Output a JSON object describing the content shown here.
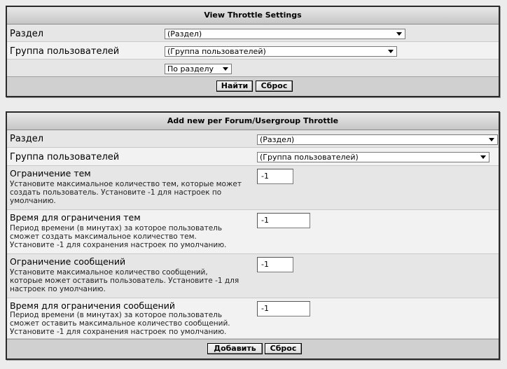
{
  "view_panel": {
    "title": "View Throttle Settings",
    "forum_label": "Раздел",
    "forum_value": "(Раздел)",
    "usergroup_label": "Группа пользователей",
    "usergroup_value": "(Группа пользователей)",
    "sort_value": "По разделу",
    "find_button": "Найти",
    "reset_button": "Сброс"
  },
  "add_panel": {
    "title": "Add new per Forum/Usergroup Throttle",
    "forum_label": "Раздел",
    "forum_value": "(Раздел)",
    "usergroup_label": "Группа пользователей",
    "usergroup_value": "(Группа пользователей)",
    "thread_limit": {
      "title": "Ограничение тем",
      "desc_1": "Установите максимальное количество тем, которые может",
      "desc_2": "создать пользователь. Установите -1 для настроек по",
      "desc_3": "умолчанию.",
      "value": "-1"
    },
    "thread_period": {
      "title": "Время для ограничения тем",
      "desc_1": "Период времени (в минутах) за которое пользователь",
      "desc_2": "сможет создать максимальное количество тем.",
      "desc_3": "Установите -1 для сохранения настроек по умолчанию.",
      "value": "-1"
    },
    "post_limit": {
      "title": "Ограничение сообщений",
      "desc_1": "Установите максимальное количество сообщений,",
      "desc_2": "которые может оставить пользователь. Установите -1 для",
      "desc_3": "настроек по умолчанию.",
      "value": "-1"
    },
    "post_period": {
      "title": "Время для ограничения сообщений",
      "desc_1": "Период времени (в минутах) за которое пользователь",
      "desc_2": "сможет оставить максимальное количество сообщений.",
      "desc_3": "Установите -1 для сохранения настроек по умолчанию.",
      "value": "-1"
    },
    "add_button": "Добавить",
    "reset_button": "Сброс"
  }
}
